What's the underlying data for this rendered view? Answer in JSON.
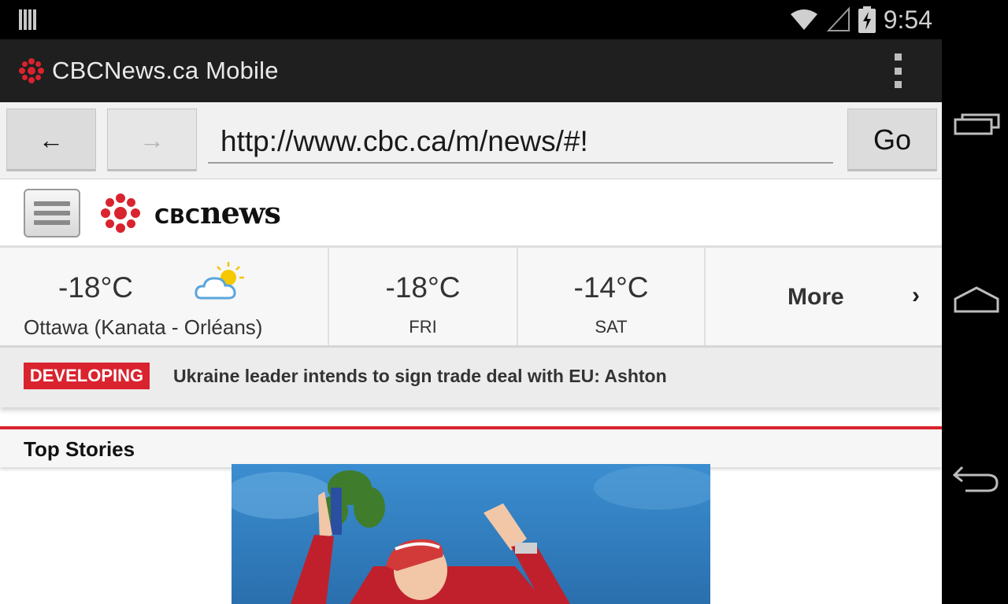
{
  "status_bar": {
    "time": "9:54",
    "icons": [
      "notification-bars-icon",
      "wifi-icon",
      "signal-icon",
      "battery-charging-icon"
    ]
  },
  "app_bar": {
    "title": "CBCNews.ca Mobile",
    "menu_icon": "overflow-menu-icon"
  },
  "browser": {
    "back_label": "←",
    "forward_label": "→",
    "url": "http://www.cbc.ca/m/news/#!",
    "go_label": "Go"
  },
  "site": {
    "brand_cbc": "CBC",
    "brand_news": "news",
    "menu_icon": "hamburger-menu-icon"
  },
  "weather": {
    "current": {
      "temp": "-18°C",
      "location": "Ottawa (Kanata - Orléans)",
      "icon": "partly-sunny-icon"
    },
    "forecast": [
      {
        "temp": "-18°C",
        "day": "FRI"
      },
      {
        "temp": "-14°C",
        "day": "SAT"
      }
    ],
    "more_label": "More",
    "more_chevron": "›"
  },
  "developing": {
    "badge": "DEVELOPING",
    "headline": "Ukraine leader intends to sign trade deal with EU: Ashton"
  },
  "top_stories": {
    "label": "Top Stories"
  },
  "system_nav": [
    "recent-apps-icon",
    "home-icon",
    "back-icon"
  ],
  "colors": {
    "cbc_red": "#d9232e",
    "action_bar": "#1f1f1f",
    "status_bar": "#000000"
  }
}
